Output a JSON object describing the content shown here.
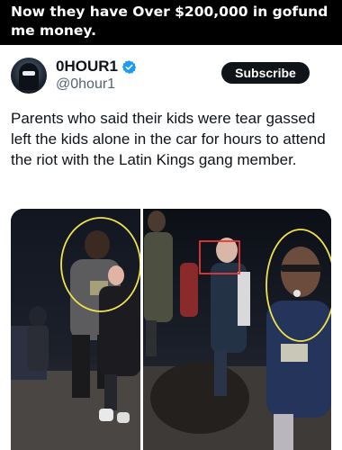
{
  "caption": "Now they have Over $200,000 in gofund me money.",
  "tweet": {
    "display_name": "0HOUR1",
    "handle": "@0hour1",
    "subscribe_label": "Subscribe",
    "text": "Parents who said their kids were tear gassed left the kids alone in the car for hours to attend the riot with the Latin Kings gang member."
  },
  "icons": {
    "verified": "verified-badge-icon",
    "avatar": "hooded-masked-figure"
  },
  "colors": {
    "verified_blue": "#1d9bf0",
    "annotation_yellow": "#f2e34b",
    "annotation_red": "#e53935"
  }
}
